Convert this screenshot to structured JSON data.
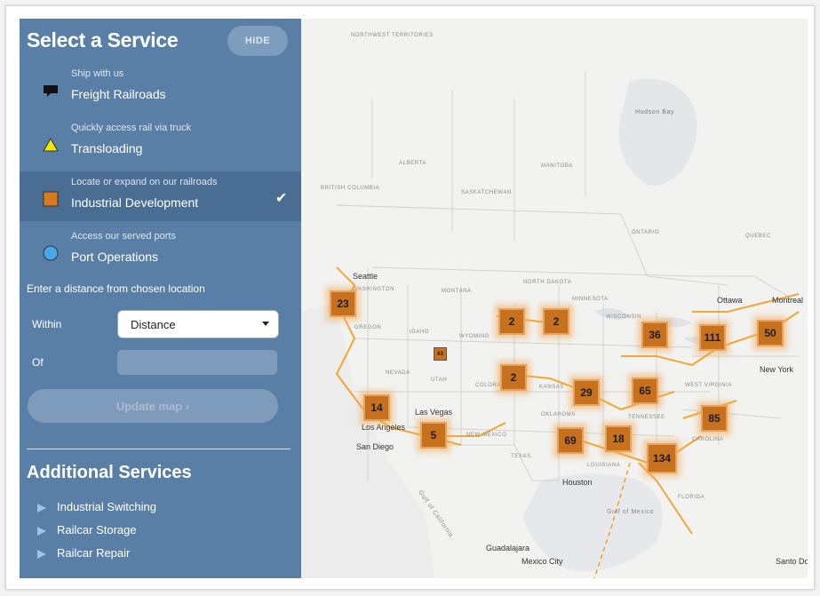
{
  "panel": {
    "title": "Select a Service",
    "hide_label": "HIDE",
    "services": [
      {
        "sub": "Ship with us",
        "label": "Freight Railroads",
        "icon": "chat-bubble-icon"
      },
      {
        "sub": "Quickly access rail via truck",
        "label": "Transloading",
        "icon": "triangle-icon"
      },
      {
        "sub": "Locate or expand on our railroads",
        "label": "Industrial Development",
        "icon": "square-icon",
        "selected": true
      },
      {
        "sub": "Access our served ports",
        "label": "Port Operations",
        "icon": "circle-icon"
      }
    ],
    "distance_prompt": "Enter a distance from chosen location",
    "within_label": "Within",
    "distance_value": "Distance",
    "of_label": "Of",
    "of_value": "",
    "update_label": "Update map ›",
    "additional_title": "Additional Services",
    "additional_items": [
      "Industrial Switching",
      "Railcar Storage",
      "Railcar Repair"
    ]
  },
  "map": {
    "region_labels": {
      "northwest_territories": "NORTHWEST TERRITORIES",
      "hudson_bay": "Hudson Bay",
      "alberta": "ALBERTA",
      "manitoba": "MANITOBA",
      "british_columbia": "BRITISH COLUMBIA",
      "saskatchewan": "SASKATCHEWAN",
      "ontario": "ONTARIO",
      "quebec": "QUEBEC",
      "washington": "WASHINGTON",
      "montana": "MONTANA",
      "north_dakota": "NORTH DAKOTA",
      "minnesota": "MINNESOTA",
      "oregon": "OREGON",
      "idaho": "IDAHO",
      "wyoming": "WYOMING",
      "wisconsin": "WISCONSIN",
      "nevada": "NEVADA",
      "utah": "UTAH",
      "colorado": "COLORADO",
      "kansas": "KANSAS",
      "new_mexico": "NEW MEXICO",
      "oklahoma": "OKLAHOMA",
      "tennessee": "TENNESSEE",
      "west_virginia": "WEST VIRGINIA",
      "carolina": "CAROLINA",
      "texas": "TEXAS",
      "louisiana": "LOUISIANA",
      "florida": "FLORIDA",
      "gulf_of_mexico": "Gulf of Mexico",
      "gulf_of_california": "Gulf of California"
    },
    "cities": {
      "seattle": "Seattle",
      "ottawa": "Ottawa",
      "montreal": "Montreal",
      "new_york": "New York",
      "las_vegas": "Las Vegas",
      "los_angeles": "Los Angeles",
      "san_diego": "San Diego",
      "houston": "Houston",
      "guadalajara": "Guadalajara",
      "mexico_city": "Mexico City",
      "santo_domingo": "Santo Domingo"
    },
    "clusters": [
      "23",
      "2",
      "2",
      "36",
      "111",
      "50",
      "2",
      "29",
      "65",
      "85",
      "14",
      "5",
      "69",
      "18",
      "134"
    ],
    "small_marker": "63"
  },
  "colors": {
    "panel": "#5a7fa6",
    "selected": "#4a6d93",
    "cluster": "#c7711f",
    "rail": "#f0a020"
  }
}
